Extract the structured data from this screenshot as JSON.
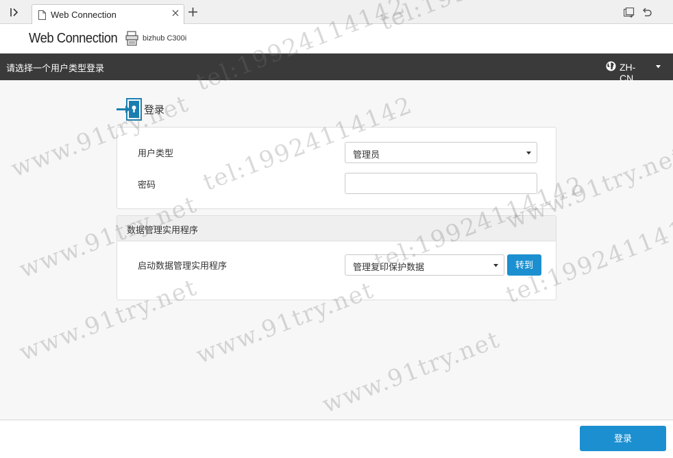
{
  "browser": {
    "tab_title": "Web Connection",
    "new_tab": "+"
  },
  "brand": {
    "name": "Web Connection",
    "model": "bizhub C300i"
  },
  "header": {
    "prompt": "请选择一个用户类型登录",
    "language": "ZH-CN"
  },
  "login": {
    "title": "登录",
    "user_type_label": "用户类型",
    "user_type_value": "管理员",
    "password_label": "密码",
    "password_value": ""
  },
  "utility": {
    "title": "数据管理实用程序",
    "launch_label": "启动数据管理实用程序",
    "launch_value": "管理复印保护数据",
    "goto_label": "转到"
  },
  "footer": {
    "login_label": "登录"
  },
  "watermarks": [
    "www.91try.net",
    "tel:19924114142",
    "www.91try.net",
    "tel:19924114142",
    "www.91try.net",
    "tel:19924114142",
    "www.91try.net",
    "tel:19924114142",
    "www.91try.net",
    "tel:19924114142",
    "www.91try.net"
  ],
  "colors": {
    "header_bg": "#3a3a3a",
    "primary": "#1b8fd0",
    "icon_accent": "#1a7fb0"
  }
}
